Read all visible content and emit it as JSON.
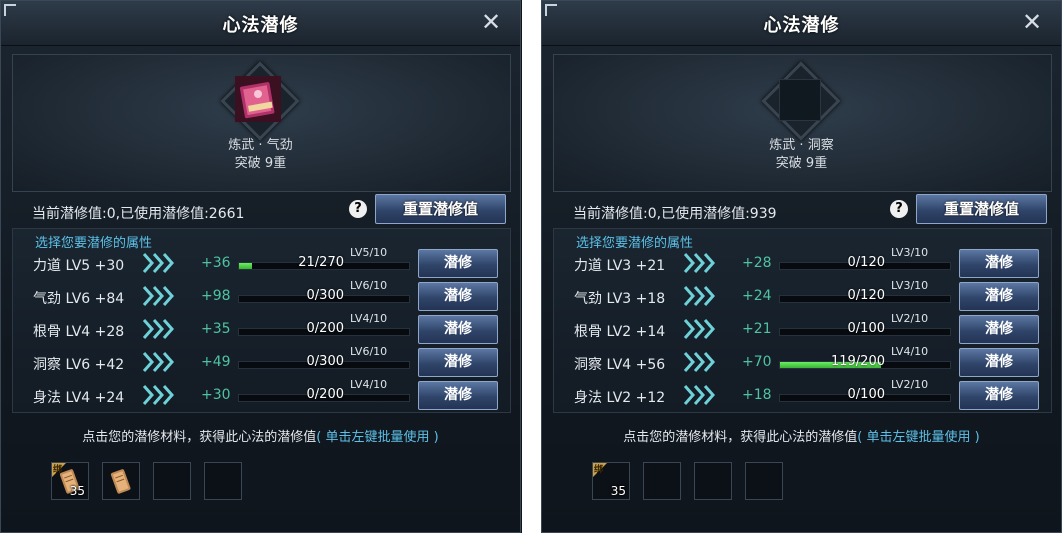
{
  "panels": [
    {
      "title": "心法潜修",
      "skill": {
        "name": "炼武 · 气劲",
        "tier": "突破 9重",
        "has_icon": true
      },
      "points_text": "当前潜修值:0,已使用潜修值:2661",
      "reset_label": "重置潜修值",
      "attr_header": "选择您要潜修的属性",
      "attrs": [
        {
          "label": "力道 LV5 +30",
          "gain": "+36",
          "level": "LV5/10",
          "progress": "21/270",
          "fill": 0.078
        },
        {
          "label": "气劲 LV6 +84",
          "gain": "+98",
          "level": "LV6/10",
          "progress": "0/300",
          "fill": 0
        },
        {
          "label": "根骨 LV4 +28",
          "gain": "+35",
          "level": "LV4/10",
          "progress": "0/200",
          "fill": 0
        },
        {
          "label": "洞察 LV6 +42",
          "gain": "+49",
          "level": "LV6/10",
          "progress": "0/300",
          "fill": 0
        },
        {
          "label": "身法 LV4 +24",
          "gain": "+30",
          "level": "LV4/10",
          "progress": "0/200",
          "fill": 0
        }
      ],
      "cultivate_label": "潜修",
      "hint_text": "点击您的潜修材料，获得此心法的潜修值",
      "hint_link": "( 单击左键批量使用 )",
      "slots": [
        {
          "filled": true,
          "bound": true,
          "bind_text": "绑",
          "count": "35"
        },
        {
          "filled": true,
          "bound": false,
          "bind_text": "",
          "count": ""
        },
        {
          "filled": false
        },
        {
          "filled": false
        }
      ]
    },
    {
      "title": "心法潜修",
      "skill": {
        "name": "炼武 · 洞察",
        "tier": "突破 9重",
        "has_icon": false
      },
      "points_text": "当前潜修值:0,已使用潜修值:939",
      "reset_label": "重置潜修值",
      "attr_header": "选择您要潜修的属性",
      "attrs": [
        {
          "label": "力道 LV3 +21",
          "gain": "+28",
          "level": "LV3/10",
          "progress": "0/120",
          "fill": 0
        },
        {
          "label": "气劲 LV3 +18",
          "gain": "+24",
          "level": "LV3/10",
          "progress": "0/120",
          "fill": 0
        },
        {
          "label": "根骨 LV2 +14",
          "gain": "+21",
          "level": "LV2/10",
          "progress": "0/100",
          "fill": 0
        },
        {
          "label": "洞察 LV4 +56",
          "gain": "+70",
          "level": "LV4/10",
          "progress": "119/200",
          "fill": 0.595
        },
        {
          "label": "身法 LV2 +12",
          "gain": "+18",
          "level": "LV2/10",
          "progress": "0/100",
          "fill": 0
        }
      ],
      "cultivate_label": "潜修",
      "hint_text": "点击您的潜修材料，获得此心法的潜修值",
      "hint_link": "( 单击左键批量使用 )",
      "slots": [
        {
          "filled": true,
          "bound": true,
          "bind_text": "绑",
          "count": "35",
          "empty_art": true
        },
        {
          "filled": false
        },
        {
          "filled": false
        },
        {
          "filled": false
        }
      ]
    }
  ],
  "icons": {
    "close": "close-icon",
    "help": "help-icon",
    "arrow": "chevron-right-icon"
  },
  "colors": {
    "gain": "#4fc3a1",
    "header": "#5cc1e8",
    "bar_fill": "#4cd044",
    "button": "#30456a"
  }
}
